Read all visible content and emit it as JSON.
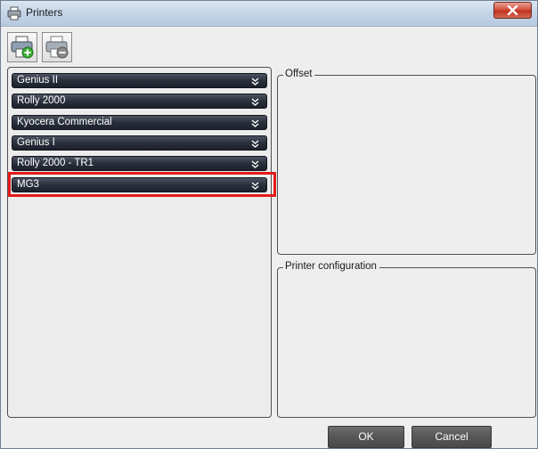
{
  "window": {
    "title": "Printers"
  },
  "toolbar": {
    "add_icon": "printer-add-icon",
    "remove_icon": "printer-remove-icon"
  },
  "printers": [
    {
      "name": "Genius II"
    },
    {
      "name": "Rolly 2000"
    },
    {
      "name": "Kyocera Commercial"
    },
    {
      "name": "Genius I"
    },
    {
      "name": "Rolly 2000 - TR1"
    },
    {
      "name": "MG3",
      "highlighted": true
    }
  ],
  "groups": {
    "offset_label": "Offset",
    "config_label": "Printer configuration"
  },
  "buttons": {
    "ok": "OK",
    "cancel": "Cancel"
  },
  "colors": {
    "item_background": "#2a2f3b",
    "highlight": "#e31b1b",
    "close_button": "#c0321f"
  }
}
